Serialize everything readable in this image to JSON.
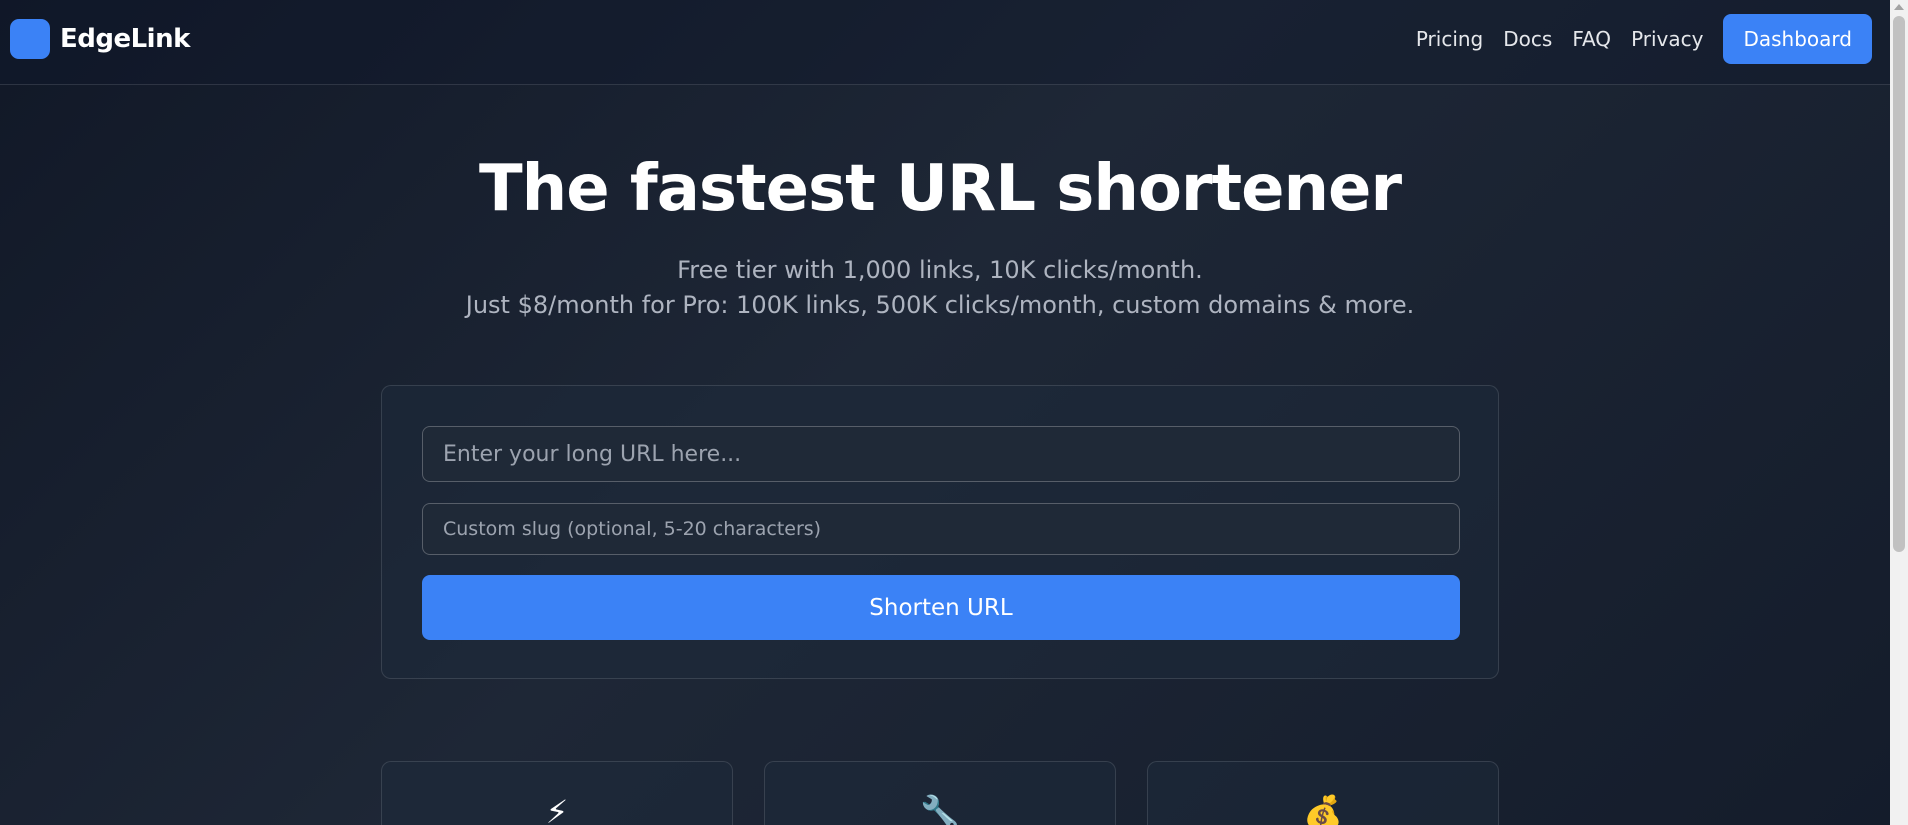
{
  "header": {
    "brand": "EdgeLink",
    "nav": [
      {
        "label": "Pricing"
      },
      {
        "label": "Docs"
      },
      {
        "label": "FAQ"
      },
      {
        "label": "Privacy"
      }
    ],
    "dashboard_label": "Dashboard"
  },
  "hero": {
    "title": "The fastest URL shortener",
    "subtitle_line1": "Free tier with 1,000 links, 10K clicks/month.",
    "subtitle_line2": "Just $8/month for Pro: 100K links, 500K clicks/month, custom domains & more."
  },
  "form": {
    "url_placeholder": "Enter your long URL here...",
    "url_value": "",
    "slug_placeholder": "Custom slug (optional, 5-20 characters)",
    "slug_value": "",
    "submit_label": "Shorten URL"
  },
  "features": [
    {
      "icon": "lightning-icon",
      "glyph": "⚡"
    },
    {
      "icon": "wrench-icon",
      "glyph": "🔧"
    },
    {
      "icon": "money-bag-icon",
      "glyph": "💰"
    }
  ],
  "colors": {
    "accent": "#3b82f6",
    "background": "#1e2736"
  }
}
